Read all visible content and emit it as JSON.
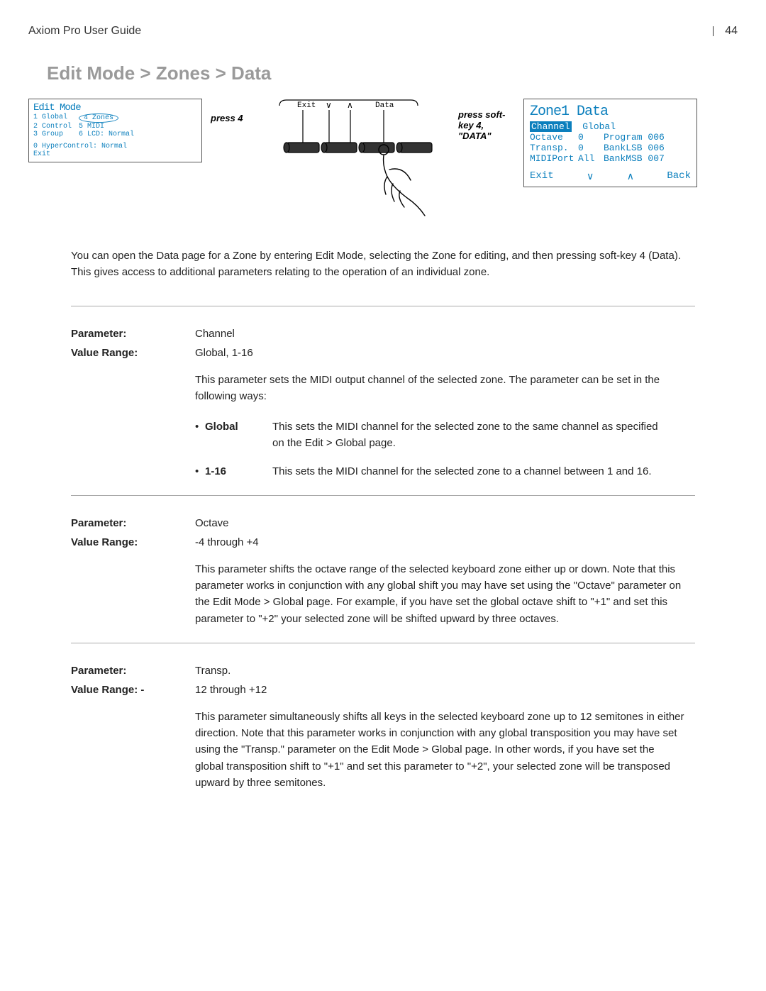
{
  "header": {
    "title": "Axiom Pro User Guide",
    "page": "44"
  },
  "title": "Edit Mode > Zones > Data",
  "fig1": {
    "topline": "Edit Mode",
    "l1a": "1 Global",
    "l1b": "4 Zones",
    "l2a": "2 Control",
    "l2b": "5 MIDI",
    "l3a": "3 Group",
    "l3b": "6 LCD: Normal",
    "l4": "0 HyperControl: Normal",
    "l5": "Exit"
  },
  "press4": "press 4",
  "fig2": {
    "t1": "Exit",
    "t2": "Data"
  },
  "press_sk": "press soft-key 4, \"DATA\"",
  "fig3": {
    "big": "Zone1 Data",
    "r1a": "Channel",
    "r1b": "Global",
    "r2a": "Octave",
    "r2b": "0",
    "r2c": "Program 006",
    "r3a": "Transp.",
    "r3b": "0",
    "r3c": "BankLSB 006",
    "r4a": "MIDIPort",
    "r4b": "All",
    "r4c": "BankMSB 007",
    "b1": "Exit",
    "b2": "Back"
  },
  "intro": "You can open the Data page for a Zone by entering Edit Mode, selecting the Zone for editing, and then pressing soft-key 4 (Data). This gives access to additional parameters relating to the operation of an individual zone.",
  "labels": {
    "parameter": "Parameter:",
    "valuerange": "Value Range:",
    "valuerange_neg": "Value Range: -"
  },
  "p1": {
    "name": "Channel",
    "range": "Global, 1-16",
    "desc": "This parameter sets the MIDI output channel of the selected zone.  The parameter can be set in the following ways:",
    "sub": [
      {
        "k": "Global",
        "t": "This sets the MIDI channel for the selected zone to the same channel as specified on the Edit > Global page."
      },
      {
        "k": "1-16",
        "t": "This sets the MIDI channel for the selected zone to a channel between 1 and 16."
      }
    ]
  },
  "p2": {
    "name": "Octave",
    "range": "-4 through +4",
    "desc": "This parameter shifts the octave range of the selected keyboard zone either up or down.  Note that this parameter works in conjunction with any global shift you may have set using the \"Octave\" parameter on the Edit Mode > Global page.  For example, if you have set the global octave shift to \"+1\" and set this parameter to \"+2\" your selected zone will be shifted upward by three octaves."
  },
  "p3": {
    "name": "Transp.",
    "range": "12 through +12",
    "desc": "This parameter simultaneously shifts all keys in the selected keyboard zone up to 12 semitones in either direction.  Note that this parameter works in conjunction with any global transposition you may have set using the \"Transp.\" parameter on the Edit Mode > Global page.  In other words, if you have set the global transposition shift to \"+1\" and set this parameter to \"+2\", your selected zone will be transposed upward by three semitones."
  }
}
